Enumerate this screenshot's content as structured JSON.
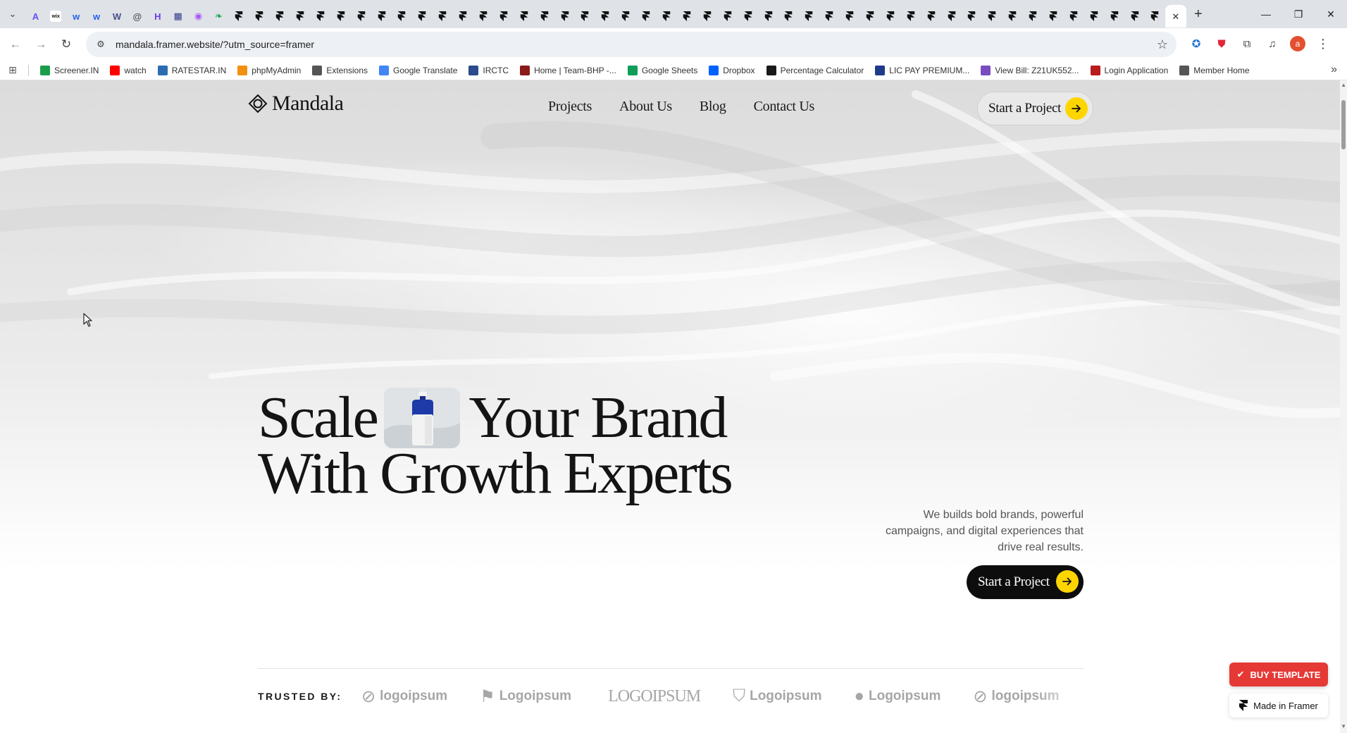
{
  "browser": {
    "tabs": [
      {
        "icon": "tab-search-icon"
      },
      {
        "icon": "arc-icon",
        "color": "#6b4cf6",
        "glyph": "A"
      },
      {
        "icon": "wix-icon",
        "color": "#ffffff",
        "glyph": "wix"
      },
      {
        "icon": "wordpress-blue-icon",
        "color": "#2563eb",
        "glyph": "w"
      },
      {
        "icon": "wordpress-blue-icon",
        "color": "#2563eb",
        "glyph": "w"
      },
      {
        "icon": "webflow-icon",
        "color": "#4b4e8a",
        "glyph": "W"
      },
      {
        "icon": "spiral-icon",
        "color": "#555555",
        "glyph": "@"
      },
      {
        "icon": "hostinger-icon",
        "color": "#673de6",
        "glyph": "H"
      },
      {
        "icon": "layout-icon",
        "color": "#2d3a8c",
        "glyph": "▦"
      },
      {
        "icon": "record-icon",
        "color": "#a855f7",
        "glyph": "◉"
      },
      {
        "icon": "leaf-icon",
        "color": "#16a34a",
        "glyph": "❧"
      }
    ],
    "framer_tab_count": 46,
    "active_tab_close": "✕",
    "new_tab": "+",
    "window_controls": [
      "—",
      "❐",
      "✕"
    ],
    "url": "mandala.framer.website/?utm_source=framer",
    "profile_initial": "a",
    "bookmarks": [
      {
        "label": "Screener.IN",
        "icon": "bar-chart-icon",
        "color": "#1b9e4b"
      },
      {
        "label": "watch",
        "icon": "youtube-icon",
        "color": "#ff0000"
      },
      {
        "label": "RATESTAR.IN",
        "icon": "star-burst-icon",
        "color": "#2b6cb0"
      },
      {
        "label": "phpMyAdmin",
        "icon": "phpmyadmin-icon",
        "color": "#f29111"
      },
      {
        "label": "Extensions",
        "icon": "puzzle-icon",
        "color": "#555555"
      },
      {
        "label": "Google Translate",
        "icon": "translate-icon",
        "color": "#4285f4"
      },
      {
        "label": "IRCTC",
        "icon": "irctc-icon",
        "color": "#2a4b8d"
      },
      {
        "label": "Home | Team-BHP -...",
        "icon": "team-bhp-icon",
        "color": "#8b1a1a"
      },
      {
        "label": "Google Sheets",
        "icon": "sheets-icon",
        "color": "#0f9d58"
      },
      {
        "label": "Dropbox",
        "icon": "dropbox-icon",
        "color": "#0061ff"
      },
      {
        "label": "Percentage Calculator",
        "icon": "percent-icon",
        "color": "#1a1a1a"
      },
      {
        "label": "LIC PAY PREMIUM...",
        "icon": "lic-icon",
        "color": "#1e3a8a"
      },
      {
        "label": "View Bill: Z21UK552...",
        "icon": "bill-icon",
        "color": "#7a4cc2"
      },
      {
        "label": "Login Application",
        "icon": "login-icon",
        "color": "#b91c1c"
      },
      {
        "label": "Member Home",
        "icon": "globe-icon",
        "color": "#555555"
      }
    ]
  },
  "site": {
    "brand": "Mandala",
    "nav": [
      "Projects",
      "About Us",
      "Blog",
      "Contact Us"
    ],
    "nav_cta": "Start a Project",
    "hero": {
      "line1_a": "Scale",
      "line1_b": "Your Brand",
      "line2": "With Growth Experts",
      "description": "We builds bold brands, powerful campaigns, and digital experiences that drive real results.",
      "cta": "Start a Project"
    },
    "trusted_label": "TRUSTED BY:",
    "logos": [
      {
        "label": "logoipsum",
        "icon": "circle-slash-logo-icon"
      },
      {
        "label": "Logoipsum",
        "icon": "flag-logo-icon"
      },
      {
        "label": "LOGOIPSUM",
        "icon": "wordmark-logo-icon"
      },
      {
        "label": "Logoipsum",
        "icon": "shield-logo-icon"
      },
      {
        "label": "Logoipsum",
        "icon": "circle-logo-icon"
      },
      {
        "label": "logoipsum",
        "icon": "circle-slash-logo-icon"
      }
    ],
    "accent_yellow": "#ffd500",
    "buy_template": "BUY TEMPLATE",
    "made_in_framer": "Made in Framer"
  }
}
